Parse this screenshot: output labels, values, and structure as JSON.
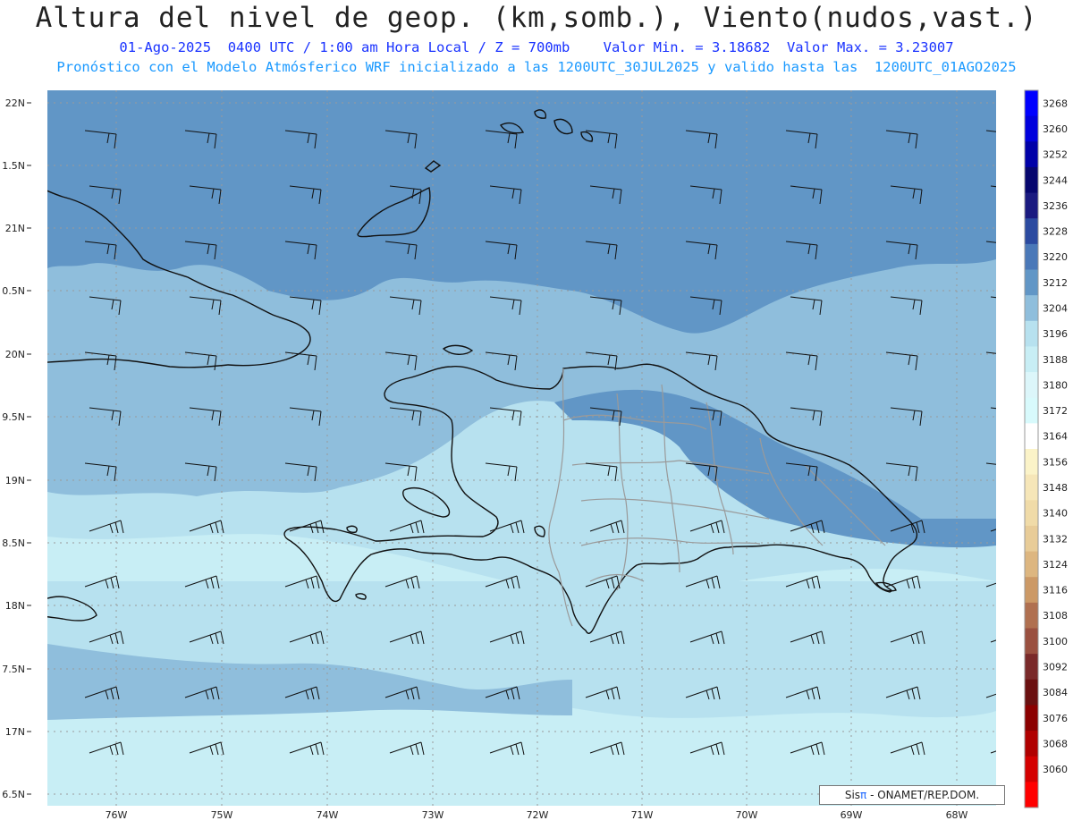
{
  "header": {
    "title": "Altura del nivel de geop. (km,somb.), Viento(nudos,vast.)",
    "line1": "01-Ago-2025  0400 UTC / 1:00 am Hora Local / Z = 700mb    Valor Min. = 3.18682  Valor Max. = 3.23007",
    "line2": "Pronóstico con el Modelo Atmósferico WRF inicializado a las 1200UTC_30JUL2025 y valido hasta las  1200UTC_01AGO2025"
  },
  "map": {
    "lat_labels": [
      "22N",
      "1.5N",
      "21N",
      "0.5N",
      "20N",
      "9.5N",
      "19N",
      "8.5N",
      "18N",
      "7.5N",
      "17N",
      "6.5N"
    ],
    "lon_labels": [
      "76W",
      "75W",
      "74W",
      "73W",
      "72W",
      "71W",
      "70W",
      "69W",
      "68W"
    ],
    "colors": {
      "deep": "#6196c6",
      "mid": "#8fbedc",
      "light": "#b7e1ef",
      "pale": "#c8eef5"
    }
  },
  "colorbar": {
    "levels": [
      "3268",
      "3260",
      "3252",
      "3244",
      "3236",
      "3228",
      "3220",
      "3212",
      "3204",
      "3196",
      "3188",
      "3180",
      "3172",
      "3164",
      "3156",
      "3148",
      "3140",
      "3132",
      "3124",
      "3116",
      "3108",
      "3100",
      "3092",
      "3084",
      "3076",
      "3068",
      "3060"
    ],
    "colors": [
      "#0000ff",
      "#0000dd",
      "#0000a8",
      "#06066e",
      "#1a1a80",
      "#2b4aa0",
      "#4a78b8",
      "#6196c6",
      "#8fbedc",
      "#b7e1ef",
      "#c8eef5",
      "#dcf6fa",
      "#d8fafc",
      "#ffffff",
      "#fbf3c8",
      "#f6e6b8",
      "#f0dba8",
      "#e8cc98",
      "#ddb680",
      "#cc9966",
      "#b07050",
      "#9a5040",
      "#7a2a2a",
      "#6a1010",
      "#8b0000",
      "#b00000",
      "#d40000",
      "#ff0000"
    ]
  },
  "credit": {
    "brand": "Sis",
    "pi": "π",
    "rest": " - ONAMET/REP.DOM."
  }
}
